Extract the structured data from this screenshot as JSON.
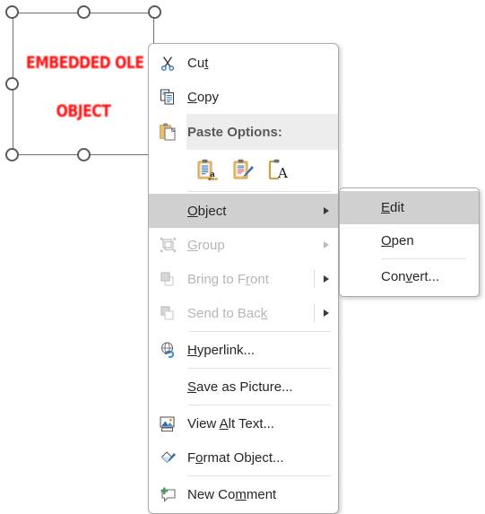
{
  "canvas": {
    "object": {
      "name": "embedded-ole-object",
      "line1": "EMBEDDED OLE",
      "line2": "OBJECT",
      "text_color": "#fb1111",
      "frame_color": "#6e6e6e",
      "selected": true,
      "handle_count": 8
    }
  },
  "context_menu": {
    "name": "object-context-menu",
    "items": [
      {
        "id": "cut",
        "label": "Cut",
        "accel": "t",
        "icon": "scissors-icon",
        "enabled": true,
        "submenu": false,
        "highlighted": false
      },
      {
        "id": "copy",
        "label": "Copy",
        "accel": "C",
        "icon": "copy-icon",
        "enabled": true,
        "submenu": false,
        "highlighted": false
      },
      {
        "id": "paste-options",
        "label": "Paste Options:",
        "accel": "",
        "icon": "clipboard-icon",
        "enabled": true,
        "submenu": false,
        "highlighted": false,
        "is_header": true
      },
      {
        "id": "object",
        "label": "Object",
        "accel": "O",
        "icon": "",
        "enabled": true,
        "submenu": true,
        "highlighted": true
      },
      {
        "id": "group",
        "label": "Group",
        "accel": "G",
        "icon": "group-icon",
        "enabled": false,
        "submenu": true,
        "highlighted": false
      },
      {
        "id": "bring-to-front",
        "label": "Bring to Front",
        "accel": "r",
        "icon": "bring-to-front-icon",
        "enabled": false,
        "submenu": true,
        "highlighted": false
      },
      {
        "id": "send-to-back",
        "label": "Send to Back",
        "accel": "k",
        "icon": "send-to-back-icon",
        "enabled": false,
        "submenu": true,
        "highlighted": false
      },
      {
        "id": "hyperlink",
        "label": "Hyperlink...",
        "accel": "H",
        "icon": "hyperlink-icon",
        "enabled": true,
        "submenu": false,
        "highlighted": false
      },
      {
        "id": "save-as-picture",
        "label": "Save as Picture...",
        "accel": "S",
        "icon": "",
        "enabled": true,
        "submenu": false,
        "highlighted": false
      },
      {
        "id": "view-alt-text",
        "label": "View Alt Text...",
        "accel": "A",
        "icon": "picture-icon",
        "enabled": true,
        "submenu": false,
        "highlighted": false
      },
      {
        "id": "format-object",
        "label": "Format Object...",
        "accel": "o",
        "icon": "format-object-icon",
        "enabled": true,
        "submenu": false,
        "highlighted": false
      },
      {
        "id": "new-comment",
        "label": "New Comment",
        "accel": "m",
        "icon": "new-comment-icon",
        "enabled": true,
        "submenu": false,
        "highlighted": false
      }
    ],
    "paste_option_buttons": [
      {
        "id": "keep-source-formatting",
        "icon": "paste-keep-source-formatting-icon"
      },
      {
        "id": "merge-formatting",
        "icon": "paste-merge-formatting-icon"
      },
      {
        "id": "keep-text-only",
        "icon": "paste-keep-text-only-icon"
      }
    ],
    "labels": {
      "cut": "Cut",
      "copy": "Copy",
      "paste_options": "Paste Options:",
      "object": "Object",
      "group": "Group",
      "bring_to_front": "Bring to Front",
      "send_to_back": "Send to Back",
      "hyperlink": "Hyperlink...",
      "save_as_picture": "Save as Picture...",
      "view_alt_text": "View Alt Text...",
      "format_object": "Format Object...",
      "new_comment": "New Comment"
    },
    "colors": {
      "highlight": "#d0d0d0",
      "header_band": "#ededed",
      "disabled_text": "#b6b6b6",
      "text": "#262626",
      "border": "#acacac"
    }
  },
  "submenu": {
    "name": "object-submenu",
    "items": [
      {
        "id": "edit",
        "label": "Edit",
        "accel": "E",
        "highlighted": true
      },
      {
        "id": "open",
        "label": "Open",
        "accel": "O",
        "highlighted": false
      },
      {
        "id": "convert",
        "label": "Convert...",
        "accel": "v",
        "highlighted": false
      }
    ],
    "labels": {
      "edit": "Edit",
      "open": "Open",
      "convert": "Convert..."
    }
  }
}
